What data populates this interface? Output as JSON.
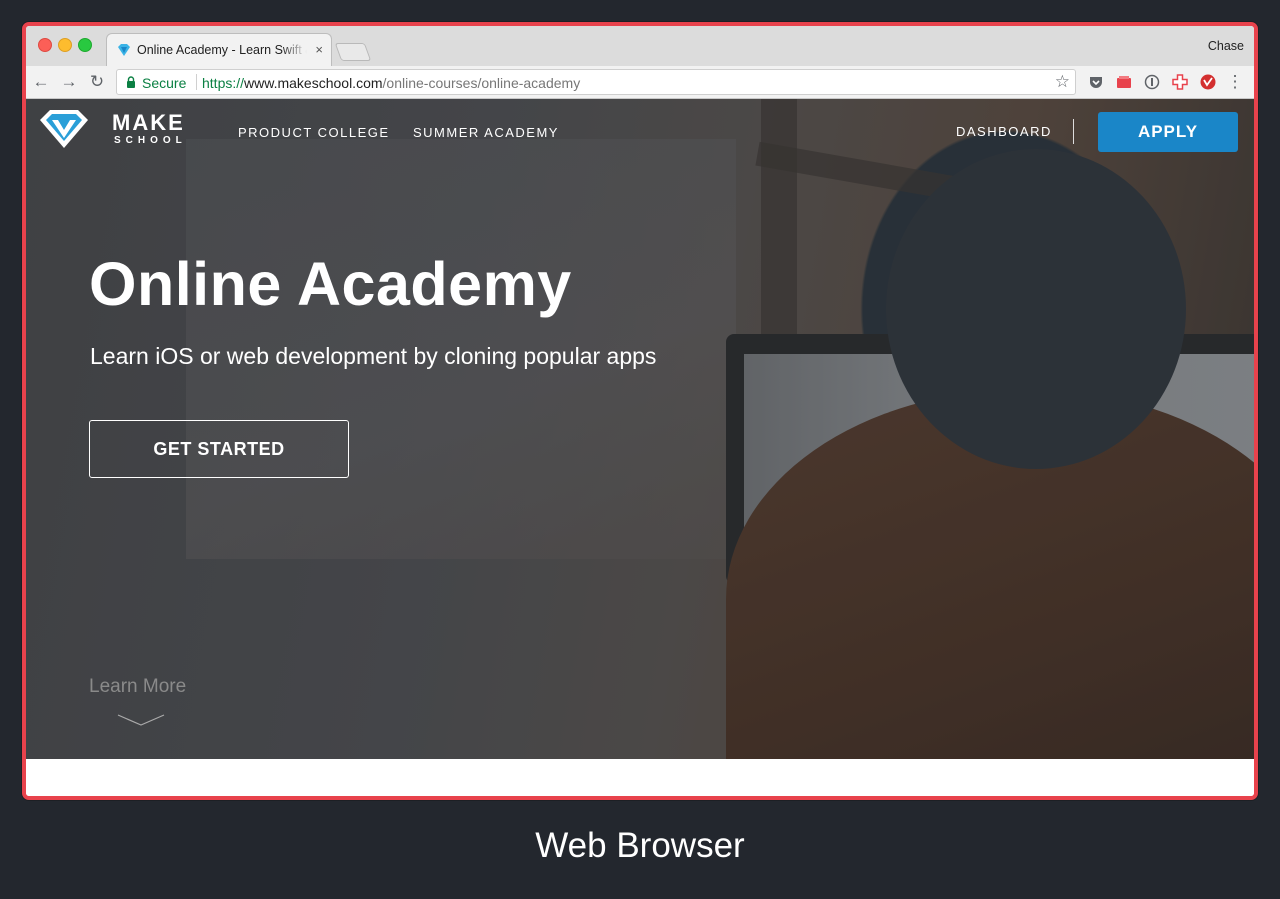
{
  "browser": {
    "tab": {
      "title": "Online Academy - Learn Swift & Web Development",
      "close_glyph": "×"
    },
    "profile_name": "Chase",
    "nav": {
      "back": "←",
      "forward": "→",
      "reload": "↻"
    },
    "omnibox": {
      "security_label": "Secure",
      "url_scheme": "https://",
      "url_host": "www.makeschool.com",
      "url_path": "/online-courses/online-academy",
      "bookmark_glyph": "☆"
    },
    "menu_glyph": "⋮",
    "frame_color": "#e8424c"
  },
  "site": {
    "logo": {
      "line1": "MAKE",
      "line2": "SCHOOL"
    },
    "nav_links": [
      "PRODUCT COLLEGE",
      "SUMMER ACADEMY"
    ],
    "dashboard_label": "DASHBOARD",
    "apply_label": "APPLY",
    "apply_color": "#1a86c8",
    "hero": {
      "title": "Online Academy",
      "subtitle": "Learn iOS or web development by cloning popular apps",
      "cta_label": "GET STARTED",
      "learn_more": "Learn More"
    }
  },
  "caption": "Web Browser"
}
